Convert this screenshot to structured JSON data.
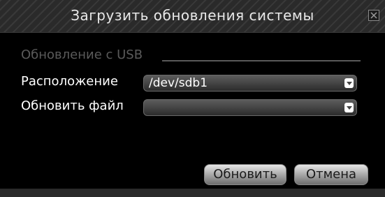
{
  "dialog": {
    "title": "Загрузить обновления системы",
    "close_icon": "close-icon"
  },
  "section": {
    "title": "Обновление с USB"
  },
  "fields": {
    "location_label": "Расположение",
    "location_value": "/dev/sdb1",
    "file_label": "Обновить файл",
    "file_value": ""
  },
  "buttons": {
    "update_label": "Обновить",
    "cancel_label": "Отмена"
  },
  "colors": {
    "background": "#000000",
    "titlebar": "#2a2a2a",
    "section_text": "#5a5a5a",
    "label_text": "#ffffff"
  }
}
